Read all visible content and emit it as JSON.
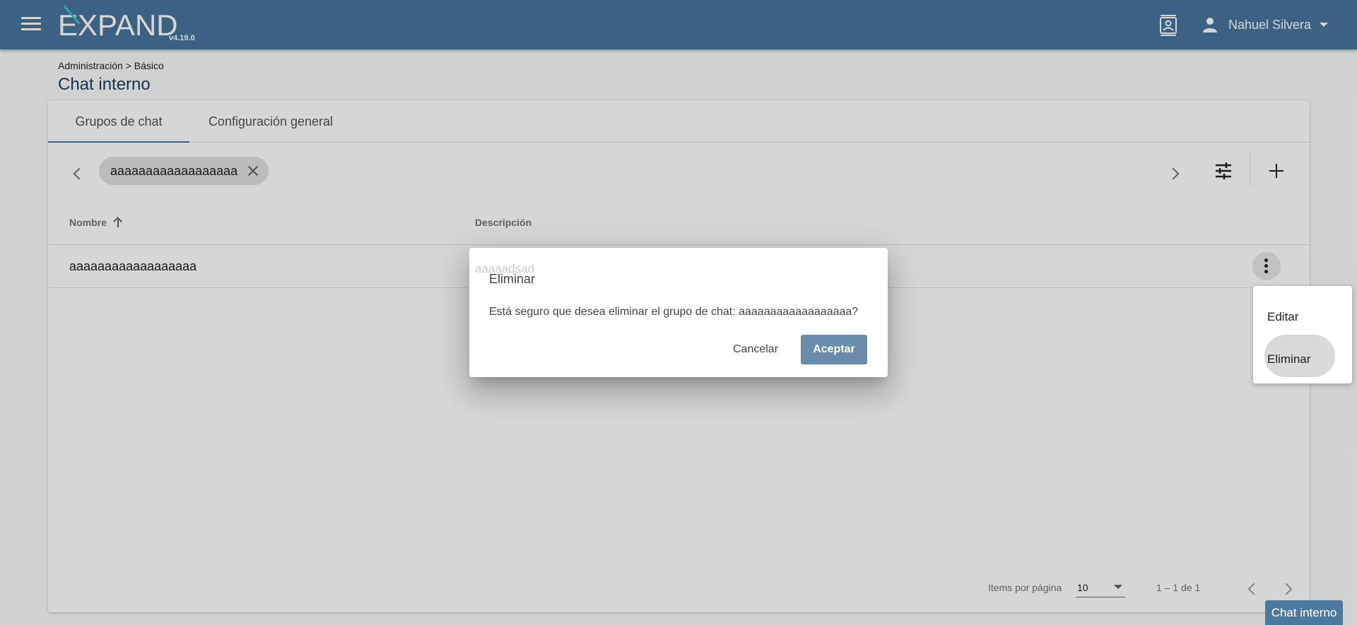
{
  "app": {
    "logo_text": "EXPAND",
    "version": "v4.19.0",
    "user_name": "Nahuel Silvera"
  },
  "breadcrumb": "Administración > Básico",
  "page_title": "Chat interno",
  "tabs": [
    {
      "label": "Grupos de chat",
      "active": true
    },
    {
      "label": "Configuración general",
      "active": false
    }
  ],
  "filter_chip": "aaaaaaaaaaaaaaaaaa",
  "table": {
    "columns": [
      "Nombre",
      "Descripción"
    ],
    "rows": [
      {
        "nombre": "aaaaaaaaaaaaaaaaaa",
        "descripcion": "aaaaadsad"
      }
    ]
  },
  "paginator": {
    "items_label": "Items por página",
    "page_size": "10",
    "range": "1 – 1 de 1"
  },
  "dialog": {
    "title": "Eliminar",
    "message": "Está seguro que desea eliminar el grupo de chat: aaaaaaaaaaaaaaaaaa?",
    "cancel_label": "Cancelar",
    "accept_label": "Aceptar"
  },
  "context_menu": [
    "Editar",
    "Eliminar"
  ],
  "chat_tab_label": "Chat interno",
  "colors": {
    "header": "#48749b",
    "title": "#1e3d5c",
    "accept_button": "#6a8ba9",
    "logo_accent": "#38c1c9"
  }
}
